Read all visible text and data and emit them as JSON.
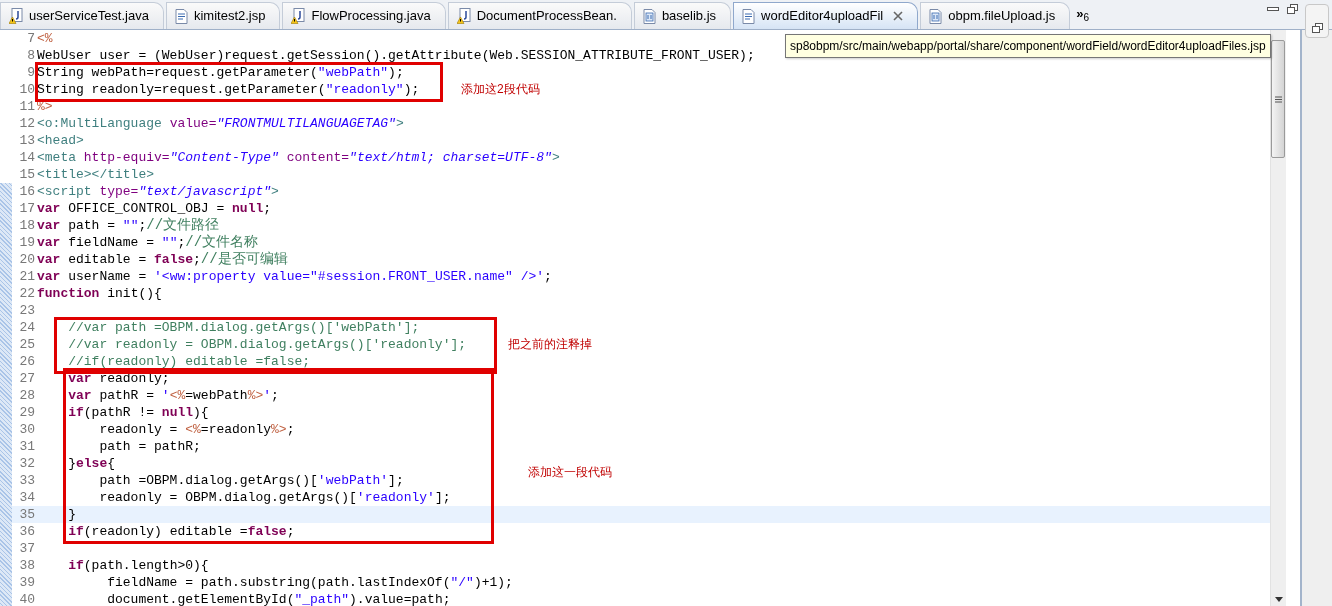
{
  "tabs": [
    {
      "label": "userServiceTest.java",
      "kind": "java-warning",
      "selected": false,
      "closable": false
    },
    {
      "label": "kimitest2.jsp",
      "kind": "jsp",
      "selected": false,
      "closable": false
    },
    {
      "label": "FlowProcessing.java",
      "kind": "java-warning",
      "selected": false,
      "closable": false
    },
    {
      "label": "DocumentProcessBean.",
      "kind": "java-warning",
      "selected": false,
      "closable": false
    },
    {
      "label": "baselib.js",
      "kind": "js",
      "selected": false,
      "closable": false
    },
    {
      "label": "wordEditor4uploadFil",
      "kind": "jsp",
      "selected": true,
      "closable": true
    },
    {
      "label": "obpm.fileUpload.js",
      "kind": "js",
      "selected": false,
      "closable": false
    }
  ],
  "overflow": {
    "arrows": "»",
    "count": "6"
  },
  "tooltip": "sp8obpm/src/main/webapp/portal/share/component/wordField/wordEditor4uploadFiles.jsp",
  "lines": [
    {
      "number": "7",
      "in_range": false,
      "current": false,
      "tokens": [
        {
          "kind": "jsp",
          "text": "<%"
        }
      ]
    },
    {
      "number": "8",
      "in_range": false,
      "current": false,
      "tokens": [
        {
          "kind": "plain",
          "text": "WebUser user = (WebUser)request.getSession().getAttribute(Web.SESSION_ATTRIBUTE_FRONT_USER);"
        }
      ]
    },
    {
      "number": "9",
      "in_range": false,
      "current": false,
      "tokens": [
        {
          "kind": "plain",
          "text": "String webPath=request.getParameter("
        },
        {
          "kind": "string",
          "text": "\"webPath\""
        },
        {
          "kind": "plain",
          "text": ");"
        }
      ]
    },
    {
      "number": "10",
      "in_range": false,
      "current": false,
      "tokens": [
        {
          "kind": "plain",
          "text": "String readonly=request.getParameter("
        },
        {
          "kind": "string",
          "text": "\"readonly\""
        },
        {
          "kind": "plain",
          "text": ");"
        }
      ]
    },
    {
      "number": "11",
      "in_range": false,
      "current": false,
      "tokens": [
        {
          "kind": "jsp",
          "text": "%>"
        }
      ]
    },
    {
      "number": "12",
      "in_range": false,
      "current": false,
      "tokens": [
        {
          "kind": "tag",
          "text": "<o:MultiLanguage"
        },
        {
          "kind": "attr",
          "text": " value="
        },
        {
          "kind": "attrval",
          "text": "\"FRONTMULTILANGUAGETAG\""
        },
        {
          "kind": "tag",
          "text": ">"
        }
      ]
    },
    {
      "number": "13",
      "in_range": false,
      "current": false,
      "tokens": [
        {
          "kind": "tag",
          "text": "<head>"
        }
      ]
    },
    {
      "number": "14",
      "in_range": false,
      "current": false,
      "tokens": [
        {
          "kind": "tag",
          "text": "<meta"
        },
        {
          "kind": "attr",
          "text": " http-equiv="
        },
        {
          "kind": "attrval",
          "text": "\"Content-Type\""
        },
        {
          "kind": "attr",
          "text": " content="
        },
        {
          "kind": "attrval",
          "text": "\"text/html; charset=UTF-8\""
        },
        {
          "kind": "tag",
          "text": ">"
        }
      ]
    },
    {
      "number": "15",
      "in_range": false,
      "current": false,
      "tokens": [
        {
          "kind": "tag",
          "text": "<title></title>"
        }
      ]
    },
    {
      "number": "16",
      "in_range": true,
      "current": false,
      "tokens": [
        {
          "kind": "tag",
          "text": "<script"
        },
        {
          "kind": "attr",
          "text": " type="
        },
        {
          "kind": "attrval",
          "text": "\"text/javascript\""
        },
        {
          "kind": "tag",
          "text": ">"
        }
      ]
    },
    {
      "number": "17",
      "in_range": true,
      "current": false,
      "tokens": [
        {
          "kind": "keyword",
          "text": "var"
        },
        {
          "kind": "plain",
          "text": " OFFICE_CONTROL_OBJ = "
        },
        {
          "kind": "keyword",
          "text": "null"
        },
        {
          "kind": "plain",
          "text": ";"
        }
      ]
    },
    {
      "number": "18",
      "in_range": true,
      "current": false,
      "tokens": [
        {
          "kind": "keyword",
          "text": "var"
        },
        {
          "kind": "plain",
          "text": " path = "
        },
        {
          "kind": "string",
          "text": "\"\""
        },
        {
          "kind": "plain",
          "text": ";"
        },
        {
          "kind": "comment",
          "text": "//文件路径"
        }
      ]
    },
    {
      "number": "19",
      "in_range": true,
      "current": false,
      "tokens": [
        {
          "kind": "keyword",
          "text": "var"
        },
        {
          "kind": "plain",
          "text": " fieldName = "
        },
        {
          "kind": "string",
          "text": "\"\""
        },
        {
          "kind": "plain",
          "text": ";"
        },
        {
          "kind": "comment",
          "text": "//文件名称"
        }
      ]
    },
    {
      "number": "20",
      "in_range": true,
      "current": false,
      "tokens": [
        {
          "kind": "keyword",
          "text": "var"
        },
        {
          "kind": "plain",
          "text": " editable = "
        },
        {
          "kind": "keyword",
          "text": "false"
        },
        {
          "kind": "plain",
          "text": ";"
        },
        {
          "kind": "comment",
          "text": "//是否可编辑"
        }
      ]
    },
    {
      "number": "21",
      "in_range": true,
      "current": false,
      "tokens": [
        {
          "kind": "keyword",
          "text": "var"
        },
        {
          "kind": "plain",
          "text": " userName = "
        },
        {
          "kind": "string",
          "text": "'<ww:property value=\"#session.FRONT_USER.name\" />'"
        },
        {
          "kind": "plain",
          "text": ";"
        }
      ]
    },
    {
      "number": "22",
      "in_range": true,
      "current": false,
      "tokens": [
        {
          "kind": "keyword",
          "text": "function"
        },
        {
          "kind": "plain",
          "text": " init(){"
        }
      ]
    },
    {
      "number": "23",
      "in_range": true,
      "current": false
    },
    {
      "number": "24",
      "in_range": true,
      "current": false,
      "tokens": [
        {
          "kind": "comment",
          "text": "    //var path =OBPM.dialog.getArgs()['webPath'];"
        }
      ]
    },
    {
      "number": "25",
      "in_range": true,
      "current": false,
      "tokens": [
        {
          "kind": "comment",
          "text": "    //var readonly = OBPM.dialog.getArgs()['readonly'];"
        }
      ]
    },
    {
      "number": "26",
      "in_range": true,
      "current": false,
      "tokens": [
        {
          "kind": "comment",
          "text": "    //if(readonly) editable =false;"
        }
      ]
    },
    {
      "number": "27",
      "in_range": true,
      "current": false,
      "tokens": [
        {
          "kind": "keyword",
          "text": "    var"
        },
        {
          "kind": "plain",
          "text": " readonly;"
        }
      ]
    },
    {
      "number": "28",
      "in_range": true,
      "current": false,
      "tokens": [
        {
          "kind": "keyword",
          "text": "    var"
        },
        {
          "kind": "plain",
          "text": " pathR = "
        },
        {
          "kind": "string",
          "text": "'"
        },
        {
          "kind": "jsp",
          "text": "<%"
        },
        {
          "kind": "plain",
          "text": "=webPath"
        },
        {
          "kind": "jsp",
          "text": "%>"
        },
        {
          "kind": "string",
          "text": "'"
        },
        {
          "kind": "plain",
          "text": ";"
        }
      ]
    },
    {
      "number": "29",
      "in_range": true,
      "current": false,
      "tokens": [
        {
          "kind": "keyword",
          "text": "    if"
        },
        {
          "kind": "plain",
          "text": "(pathR != "
        },
        {
          "kind": "keyword",
          "text": "null"
        },
        {
          "kind": "plain",
          "text": "){"
        }
      ]
    },
    {
      "number": "30",
      "in_range": true,
      "current": false,
      "tokens": [
        {
          "kind": "plain",
          "text": "        readonly = "
        },
        {
          "kind": "jsp",
          "text": "<%"
        },
        {
          "kind": "plain",
          "text": "=readonly"
        },
        {
          "kind": "jsp",
          "text": "%>"
        },
        {
          "kind": "plain",
          "text": ";"
        }
      ]
    },
    {
      "number": "31",
      "in_range": true,
      "current": false,
      "tokens": [
        {
          "kind": "plain",
          "text": "        path = pathR;"
        }
      ]
    },
    {
      "number": "32",
      "in_range": true,
      "current": false,
      "tokens": [
        {
          "kind": "plain",
          "text": "    }"
        },
        {
          "kind": "keyword",
          "text": "else"
        },
        {
          "kind": "plain",
          "text": "{"
        }
      ]
    },
    {
      "number": "33",
      "in_range": true,
      "current": false,
      "tokens": [
        {
          "kind": "plain",
          "text": "        path =OBPM.dialog.getArgs()["
        },
        {
          "kind": "string",
          "text": "'webPath'"
        },
        {
          "kind": "plain",
          "text": "];"
        }
      ]
    },
    {
      "number": "34",
      "in_range": true,
      "current": false,
      "tokens": [
        {
          "kind": "plain",
          "text": "        readonly = OBPM.dialog.getArgs()["
        },
        {
          "kind": "string",
          "text": "'readonly'"
        },
        {
          "kind": "plain",
          "text": "];"
        }
      ]
    },
    {
      "number": "35",
      "in_range": true,
      "current": true,
      "tokens": [
        {
          "kind": "plain",
          "text": "    }"
        }
      ]
    },
    {
      "number": "36",
      "in_range": true,
      "current": false,
      "tokens": [
        {
          "kind": "keyword",
          "text": "    if"
        },
        {
          "kind": "plain",
          "text": "(readonly) editable ="
        },
        {
          "kind": "keyword",
          "text": "false"
        },
        {
          "kind": "plain",
          "text": ";"
        }
      ]
    },
    {
      "number": "37",
      "in_range": true,
      "current": false
    },
    {
      "number": "38",
      "in_range": true,
      "current": false,
      "tokens": [
        {
          "kind": "keyword",
          "text": "    if"
        },
        {
          "kind": "plain",
          "text": "(path.length>0){"
        }
      ]
    },
    {
      "number": "39",
      "in_range": true,
      "current": false,
      "tokens": [
        {
          "kind": "plain",
          "text": "         fieldName = path.substring(path.lastIndexOf("
        },
        {
          "kind": "string",
          "text": "\"/\""
        },
        {
          "kind": "plain",
          "text": ")+1);"
        }
      ]
    },
    {
      "number": "40",
      "in_range": true,
      "current": false,
      "tokens": [
        {
          "kind": "plain",
          "text": "         document.getElementById("
        },
        {
          "kind": "string",
          "text": "\"_path\""
        },
        {
          "kind": "plain",
          "text": ").value=path;"
        }
      ]
    }
  ],
  "annotations": [
    {
      "note": "添加这2段代码"
    },
    {
      "note": "把之前的注释掉"
    },
    {
      "note": "添加这一段代码"
    }
  ]
}
